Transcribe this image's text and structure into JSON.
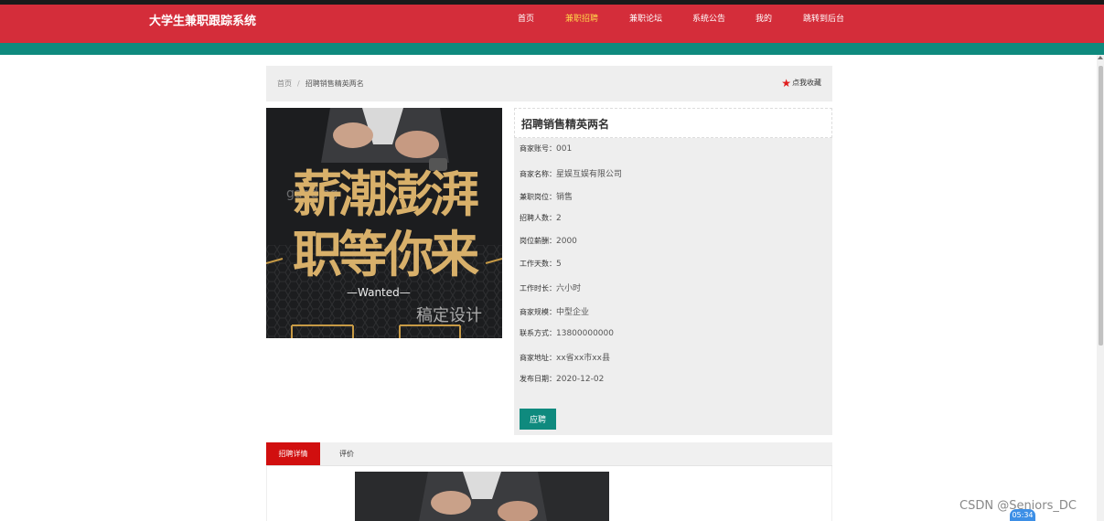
{
  "header": {
    "brand": "大学生兼职跟踪系统",
    "nav": [
      {
        "label": "首页",
        "active": false
      },
      {
        "label": "兼职招聘",
        "active": true
      },
      {
        "label": "兼职论坛",
        "active": false
      },
      {
        "label": "系统公告",
        "active": false
      },
      {
        "label": "我的",
        "active": false
      },
      {
        "label": "跳转到后台",
        "active": false
      }
    ]
  },
  "breadcrumb": {
    "home": "首页",
    "separator": "/",
    "current": "招聘销售精英两名"
  },
  "favorite": {
    "icon": "star-icon",
    "label": "点我收藏"
  },
  "poster": {
    "line1": "薪潮澎湃",
    "line2": "职等你来",
    "wanted": "—Wanted—",
    "design": "稿定设计",
    "watermark": "gaoding"
  },
  "job": {
    "title": "招聘销售精英两名",
    "fields": [
      {
        "key": "商家账号：",
        "value": "001"
      },
      {
        "key": "商家名称：",
        "value": "星娱互娱有限公司"
      },
      {
        "key": "兼职岗位：",
        "value": "销售"
      },
      {
        "key": "招聘人数：",
        "value": "2"
      },
      {
        "key": "岗位薪酬：",
        "value": "2000"
      },
      {
        "key": "工作天数：",
        "value": "5"
      },
      {
        "key": "工作时长：",
        "value": "六小时"
      },
      {
        "key": "商家规模：",
        "value": "中型企业"
      },
      {
        "key": "联系方式：",
        "value": "13800000000"
      },
      {
        "key": "商家地址：",
        "value": "xx省xx市xx县"
      },
      {
        "key": "发布日期：",
        "value": "2020-12-02"
      }
    ],
    "apply_label": "应聘"
  },
  "tabs": [
    {
      "label": "招聘详情",
      "active": true
    },
    {
      "label": "评价",
      "active": false
    }
  ],
  "watermark": {
    "text": "CSDN @Seniors_DC",
    "time": "05:34"
  },
  "colors": {
    "primary_red": "#d42d3a",
    "teal": "#0f8a7e",
    "tab_red": "#d10f0f",
    "gold": "#d8b06a"
  }
}
